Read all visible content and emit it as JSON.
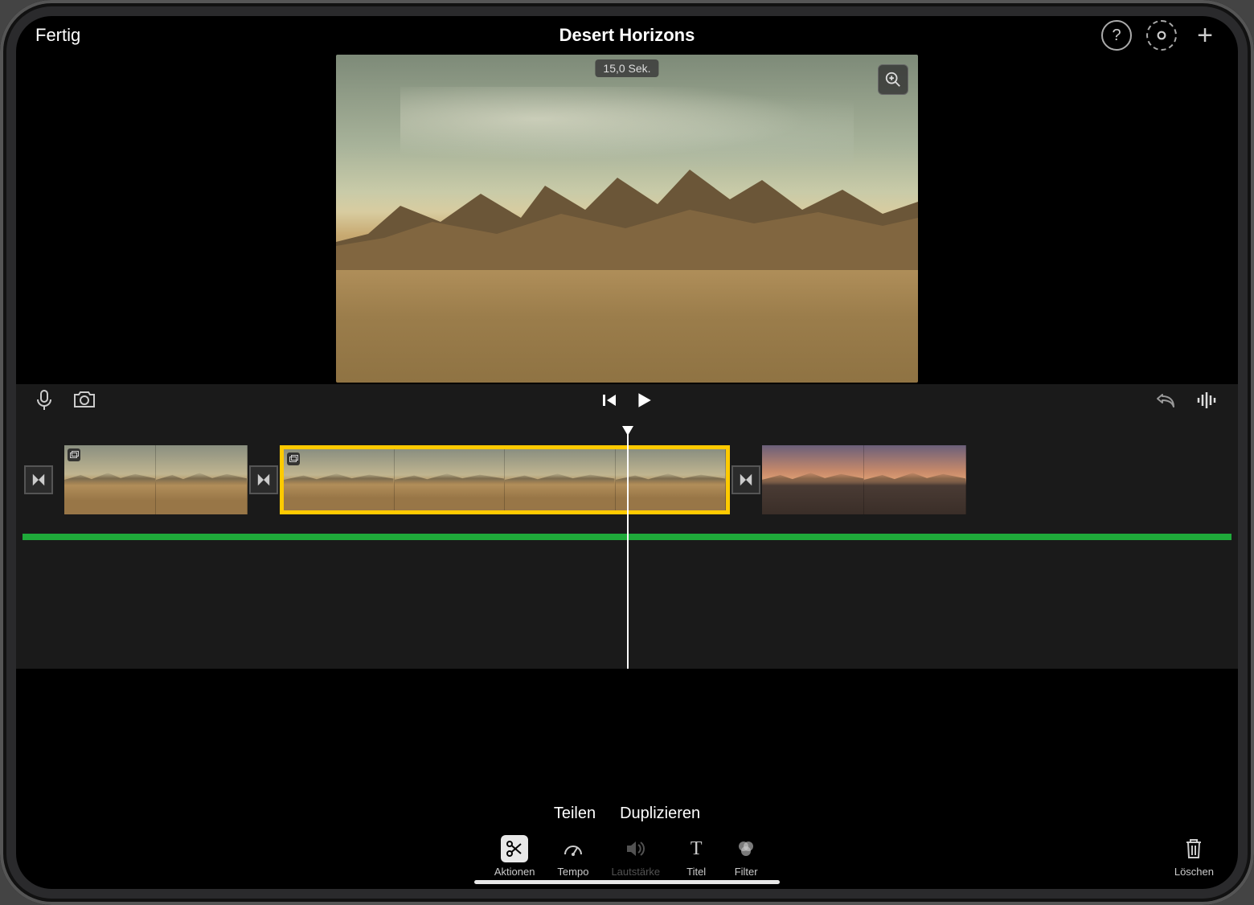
{
  "header": {
    "done_label": "Fertig",
    "title": "Desert Horizons"
  },
  "viewer": {
    "duration_badge": "15,0 Sek."
  },
  "actions": {
    "split": "Teilen",
    "duplicate": "Duplizieren"
  },
  "tools": {
    "actions": "Aktionen",
    "tempo": "Tempo",
    "volume": "Lautstärke",
    "title": "Titel",
    "filter": "Filter"
  },
  "delete_label": "Löschen",
  "icons": {
    "help": "help-icon",
    "settings": "gear-icon",
    "add": "plus-icon",
    "mic": "microphone-icon",
    "camera": "camera-icon",
    "skip_back": "skip-back-icon",
    "play": "play-icon",
    "undo": "undo-icon",
    "waveform": "waveform-icon",
    "zoom": "magnify-plus-icon",
    "transition": "transition-icon",
    "scissors": "scissors-icon",
    "gauge": "gauge-icon",
    "speaker": "speaker-icon",
    "text_t": "text-icon",
    "filter_circles": "filter-icon",
    "trash": "trash-icon"
  }
}
